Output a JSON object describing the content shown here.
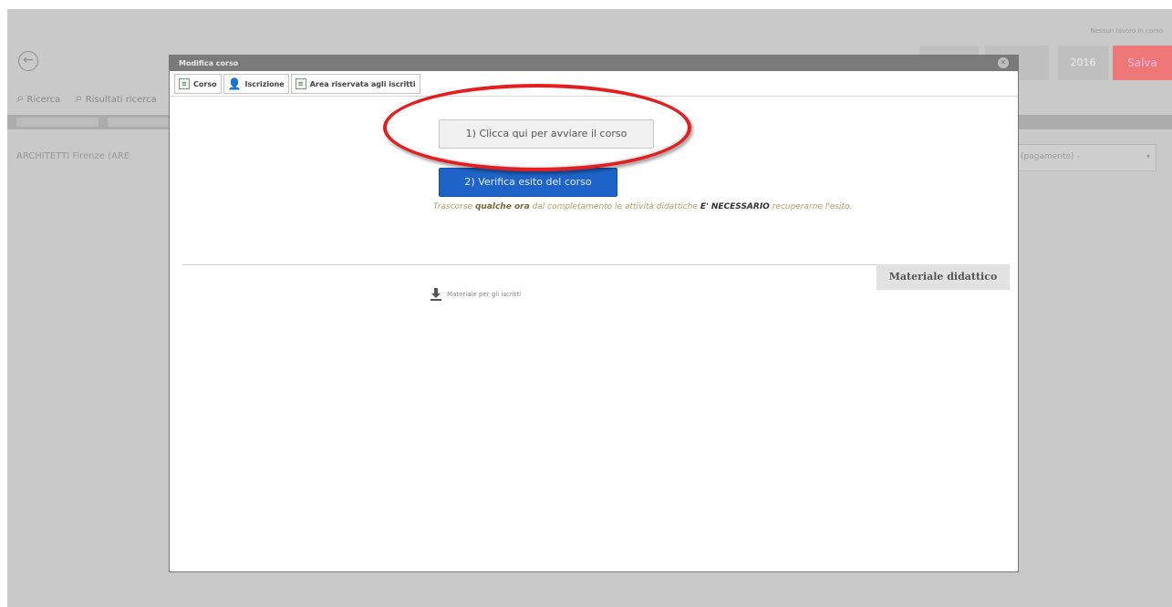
{
  "app": {
    "top_right": "Nessun lavoro in corso",
    "back_icon": "circle-arrow-left-icon",
    "toolbar": [
      {
        "label": "Ricerca",
        "icon": "magnifier-icon"
      },
      {
        "label": "Risultati ricerca",
        "icon": "magnifier-icon"
      }
    ],
    "row_text": "ARCHITETTI Firenze (ARE",
    "buttons": [
      "",
      "",
      "2016",
      "Salva"
    ],
    "select_value": "(pagamento) -"
  },
  "modal": {
    "title": "Modifica corso",
    "close_icon": "close-icon",
    "tabs": [
      {
        "label": "Corso",
        "icon": "form-icon"
      },
      {
        "label": "Iscrizione",
        "icon": "person-icon"
      },
      {
        "label": "Area riservata agli iscritti",
        "icon": "form-icon"
      }
    ],
    "start_button": "1) Clicca qui per avviare il corso",
    "verify_button": "2) Verifica esito del corso",
    "note": {
      "prefix": "Trascorse",
      "bold1": "qualche ora",
      "middle": "dal completamento le attività didattiche",
      "bold2": "E' NECESSARIO",
      "suffix": "recuperarne l'esito."
    },
    "materials_title": "Materiale didattico",
    "materials_link": "Materiale per gli iscritti",
    "download_icon": "download-icon"
  },
  "colors": {
    "annotation": "#e41e1e",
    "primary_button": "#1e63c8",
    "modal_title_bar": "#7a7a7a"
  }
}
